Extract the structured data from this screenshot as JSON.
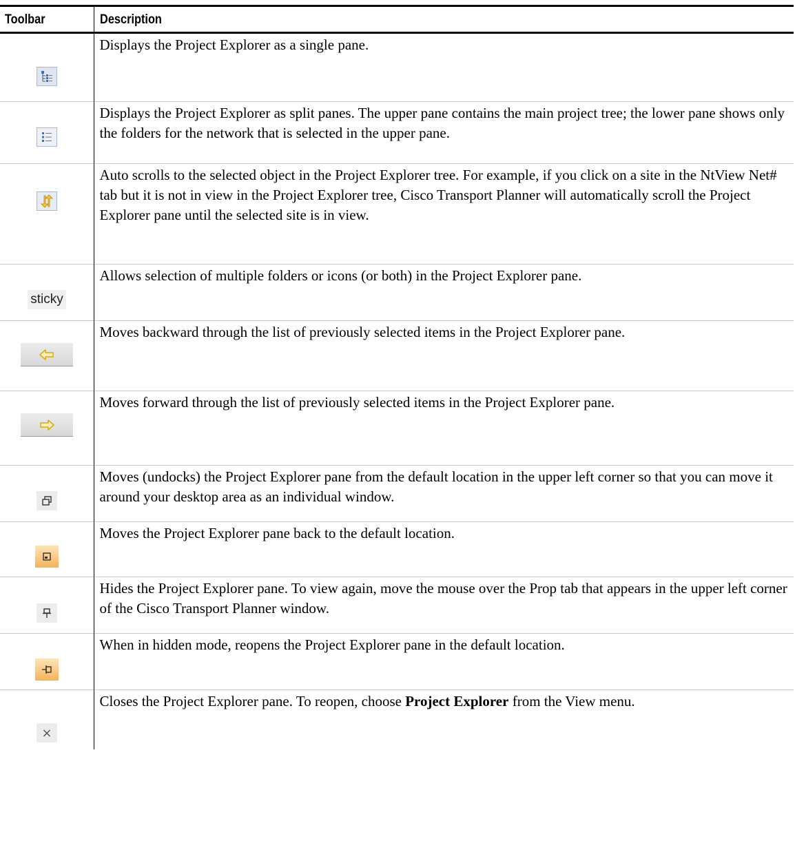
{
  "table": {
    "headers": {
      "toolbar": "Toolbar",
      "description": "Description"
    },
    "rows": [
      {
        "icon": "single-pane-tree-icon",
        "description": "Displays the Project Explorer as a single pane."
      },
      {
        "icon": "split-pane-list-icon",
        "description": "Displays the Project Explorer as split panes. The upper pane contains the main project tree; the lower pane shows only the folders for the network that is selected in the upper pane."
      },
      {
        "icon": "auto-scroll-arrows-icon",
        "description": "Auto scrolls to the selected object in the Project Explorer tree. For example, if you click on a site in the NtView Net# tab but it is not in view in the Project Explorer tree, Cisco Transport Planner will automatically scroll the Project Explorer pane until the selected site is in view."
      },
      {
        "icon": "sticky-button",
        "icon_label": "sticky",
        "description": "Allows selection of multiple folders or icons (or both) in the Project Explorer pane."
      },
      {
        "icon": "back-arrow-icon",
        "description": "Moves backward through the list of previously selected items in the Project Explorer pane."
      },
      {
        "icon": "forward-arrow-icon",
        "description": "Moves forward through the list of previously selected items in the Project Explorer pane."
      },
      {
        "icon": "undock-window-icon",
        "description": "Moves (undocks) the Project Explorer pane from the default location in the upper left corner so that you can move it around your desktop area as an individual window."
      },
      {
        "icon": "dock-window-icon",
        "description": "Moves the Project Explorer pane back to the default location."
      },
      {
        "icon": "pin-vertical-icon",
        "description": "Hides the Project Explorer pane. To view again, move the mouse over the Prop tab that appears in the upper left corner of the Cisco Transport Planner window."
      },
      {
        "icon": "pin-horizontal-icon",
        "description": "When in hidden mode, reopens the Project Explorer pane in the default location."
      },
      {
        "icon": "close-icon",
        "description_before": "Closes the Project Explorer pane. To reopen, choose ",
        "description_bold": "Project Explorer",
        "description_after": " from the View menu."
      }
    ]
  },
  "colors": {
    "accent_orange": "#f7b25a",
    "arrow_yellow": "#f5c542",
    "icon_blue": "#3a6fc4"
  }
}
